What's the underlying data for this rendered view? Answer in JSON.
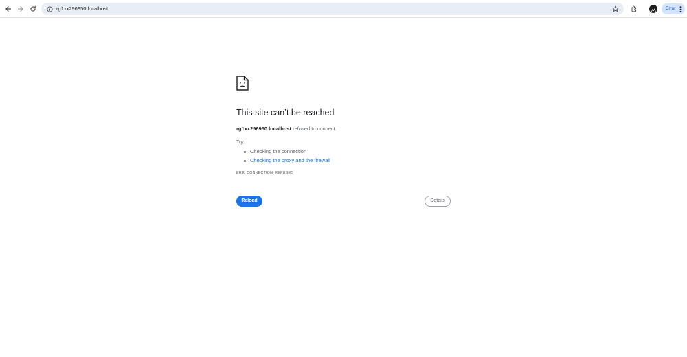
{
  "browser": {
    "url": "rg1xx296950.localhost",
    "status_chip": "Error",
    "icons": {
      "back": "arrow-left-icon",
      "forward": "arrow-right-icon",
      "reload": "reload-icon",
      "site_info": "info-icon",
      "bookmark": "star-icon",
      "extensions": "puzzle-icon",
      "profile": "avatar",
      "menu": "more-vert-icon"
    }
  },
  "error_page": {
    "icon": "sad-document-icon",
    "title": "This site can’t be reached",
    "host": "rg1xx296950.localhost",
    "message": " refused to connect.",
    "try_label": "Try:",
    "suggestions": [
      {
        "text": "Checking the connection",
        "is_link": false
      },
      {
        "text": "Checking the proxy and the firewall",
        "is_link": true
      }
    ],
    "error_code": "ERR_CONNECTION_REFUSED",
    "reload_label": "Reload",
    "details_label": "Details"
  },
  "colors": {
    "accent": "#1a73e8",
    "omnibox_bg": "#e9eef6",
    "chip_bg": "#d3e3fd",
    "text_secondary": "#5f6368"
  }
}
